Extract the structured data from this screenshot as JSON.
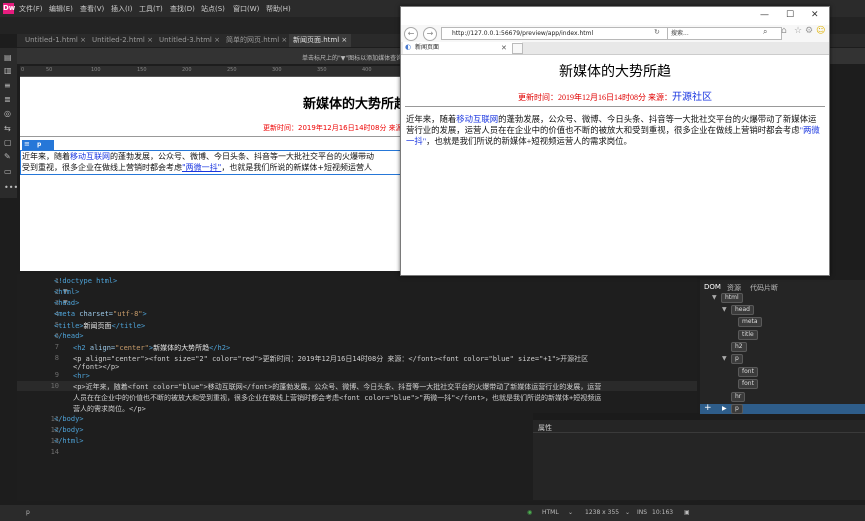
{
  "menubar": {
    "logo": "Dw",
    "items": [
      "文件(F)",
      "编辑(E)",
      "查看(V)",
      "插入(I)",
      "工具(T)",
      "查找(D)",
      "站点(S)",
      "窗口(W)",
      "帮助(H)"
    ]
  },
  "tabs": [
    {
      "label": "Untitled-1.html ×"
    },
    {
      "label": "Untitled-2.html ×"
    },
    {
      "label": "Untitled-3.html ×"
    },
    {
      "label": "简单的网页.html ×"
    },
    {
      "label": "新闻页面.html ×"
    }
  ],
  "hint": "单击标尺上的\"▼\"图标以添加媒体查询",
  "ruler_ticks": [
    "0",
    "50",
    "100",
    "150",
    "200",
    "250",
    "300",
    "350",
    "400"
  ],
  "live": {
    "h2": "新媒体的大势所趋",
    "date_line": "更新时间：2019年12月16日14时08分 来源：",
    "sel_tag": "p",
    "p_line1_a": "近年来，随着",
    "p_line1_link": "移动互联网",
    "p_line1_b": "的蓬勃发展，公众号、微博、今日头条、抖音等一大批社交平台的火爆带动",
    "p_line2_a": "受到重视，很多企业在做线上营销时都会考虑",
    "p_line2_link": "\"两微一抖\"",
    "p_line2_b": "，也就是我们所说的新媒体+短视频运营人"
  },
  "code": {
    "line_numbers": [
      "1",
      "2",
      "3",
      "4",
      "5",
      "6",
      "7",
      "8",
      "9",
      "",
      "10",
      "",
      "",
      "11",
      "12",
      "13",
      "14"
    ],
    "lines": {
      "l1": "<!doctype html>",
      "l2": "<html>",
      "l3": "<head>",
      "l4_tag": "<meta ",
      "l4_attr": "charset=",
      "l4_val": "\"utf-8\"",
      "l4_end": ">",
      "l5_open": "<title>",
      "l5_text": "新闻页面",
      "l5_close": "</title>",
      "l6": "</head>",
      "l7_open": "<h2 ",
      "l7_attr": "align=",
      "l7_val": "\"center\"",
      "l7_gt": ">",
      "l7_text": "新媒体的大势所趋",
      "l7_close": "</h2>",
      "l8": "<p align=\"center\"><font size=\"2\" color=\"red\">更新时间：2019年12月16日14时08分 来源：</font><font color=\"blue\" size=\"+1\">开源社区",
      "l8b": "</font></p>",
      "l9": "<hr>",
      "l10a": "<p>近年来，随着<font color=\"blue\">移动互联网</font>的蓬勃发展，公众号、微博、今日头条、抖音等一大批社交平台的火爆带动了新媒体运营行业的发展，运营",
      "l10b": "人员在在企业中的价值也不断的被放大和受到重视，很多企业在做线上营销时都会考虑<font color=\"blue\">\"两微一抖\"</font>，也就是我们所说的新媒体+短视频运",
      "l10c": "营人的需求岗位。</p>",
      "l11": "</body>",
      "l12": "</body>",
      "l13": "</html>"
    }
  },
  "dom_panel": {
    "tabs": [
      "DOM",
      "资源",
      "代码片断"
    ],
    "nodes": [
      "html",
      "head",
      "meta",
      "title",
      "h2",
      "p",
      "font",
      "font",
      "hr",
      "p"
    ]
  },
  "properties_title": "属性",
  "status": {
    "tag": "p",
    "lang": "HTML",
    "size": "1238 x 355",
    "ins": "INS",
    "pos": "10:163"
  },
  "browser": {
    "title_right": "—        ☐        ✕",
    "url": "http://127.0.0.1:56679/preview/app/index.html",
    "search_placeholder": "搜索...",
    "tab_label": "新闻页面",
    "h2": "新媒体的大势所趋",
    "date_red": "更新时间：2019年12月16日14时08分 来源：",
    "date_blue": "开源社区",
    "p_a": "近年来，随着",
    "p_link1": "移动互联网",
    "p_b": "的蓬勃发展，公众号、微博、今日头条、抖音等一大批社交平台的火爆带动了新媒体运营行业的发展，运营人员在在企业中的价值也不断的被放大和受到重视，很多企业在做线上营销时都会考虑",
    "p_link2": "\"两微一抖\"",
    "p_c": "，也就是我们所说的新媒体+短视频运营人的需求岗位。"
  },
  "colors": {
    "accent": "#2677d8",
    "red": "#e00000",
    "blue": "#1a36e0",
    "logo": "#e81c7f"
  }
}
